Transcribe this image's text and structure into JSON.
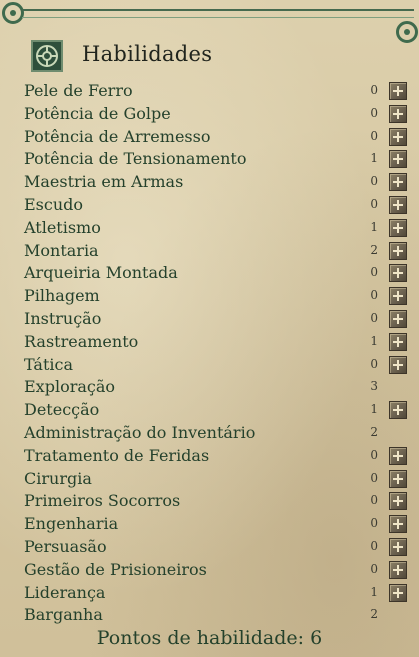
{
  "header": {
    "title": "Habilidades",
    "icon": "skills-emblem-icon"
  },
  "skills": [
    {
      "name": "Pele de Ferro",
      "value": "0",
      "can_increase": true
    },
    {
      "name": "Potência de Golpe",
      "value": "0",
      "can_increase": true
    },
    {
      "name": "Potência de Arremesso",
      "value": "0",
      "can_increase": true
    },
    {
      "name": "Potência de Tensionamento",
      "value": "1",
      "can_increase": true
    },
    {
      "name": "Maestria em Armas",
      "value": "0",
      "can_increase": true
    },
    {
      "name": "Escudo",
      "value": "0",
      "can_increase": true
    },
    {
      "name": "Atletismo",
      "value": "1",
      "can_increase": true
    },
    {
      "name": "Montaria",
      "value": "2",
      "can_increase": true
    },
    {
      "name": "Arqueiria Montada",
      "value": "0",
      "can_increase": true
    },
    {
      "name": "Pilhagem",
      "value": "0",
      "can_increase": true
    },
    {
      "name": "Instrução",
      "value": "0",
      "can_increase": true
    },
    {
      "name": "Rastreamento",
      "value": "1",
      "can_increase": true
    },
    {
      "name": "Tática",
      "value": "0",
      "can_increase": true
    },
    {
      "name": "Exploração",
      "value": "3",
      "can_increase": false
    },
    {
      "name": "Detecção",
      "value": "1",
      "can_increase": true
    },
    {
      "name": "Administração do Inventário",
      "value": "2",
      "can_increase": false
    },
    {
      "name": "Tratamento de Feridas",
      "value": "0",
      "can_increase": true
    },
    {
      "name": "Cirurgia",
      "value": "0",
      "can_increase": true
    },
    {
      "name": "Primeiros Socorros",
      "value": "0",
      "can_increase": true
    },
    {
      "name": "Engenharia",
      "value": "0",
      "can_increase": true
    },
    {
      "name": "Persuasão",
      "value": "0",
      "can_increase": true
    },
    {
      "name": "Gestão de Prisioneiros",
      "value": "0",
      "can_increase": true
    },
    {
      "name": "Liderança",
      "value": "1",
      "can_increase": true
    },
    {
      "name": "Barganha",
      "value": "2",
      "can_increase": false
    }
  ],
  "footer": {
    "points_text": "Pontos de habilidade: 6"
  },
  "colors": {
    "parchment": "#d6c8a3",
    "text_green": "#25412c",
    "accent_green": "#3f6a4d",
    "button": "#6c6250"
  }
}
